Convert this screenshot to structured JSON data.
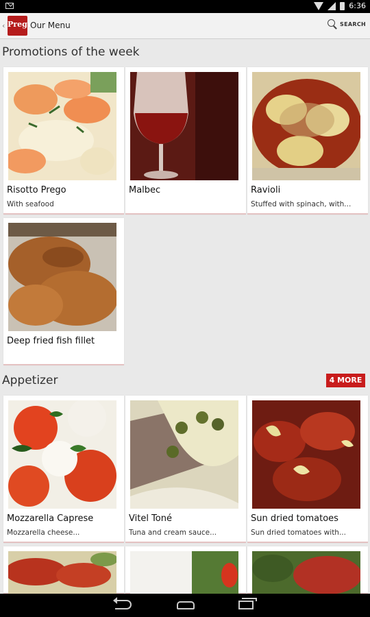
{
  "status": {
    "time": "6:36"
  },
  "app": {
    "title": "Our Menu",
    "logo_text": "Prego",
    "search_label": "SEARCH"
  },
  "sections": [
    {
      "title": "Promotions of the week",
      "items": [
        {
          "name": "Risotto Prego",
          "description": "With seafood"
        },
        {
          "name": "Malbec",
          "description": ""
        },
        {
          "name": "Ravioli",
          "description": "Stuffed with spinach, with..."
        },
        {
          "name": "Deep fried fish fillet",
          "description": ""
        }
      ]
    },
    {
      "title": "Appetizer",
      "more_label": "4 MORE",
      "items": [
        {
          "name": "Mozzarella Caprese",
          "description": "Mozzarella cheese..."
        },
        {
          "name": "Vitel Toné",
          "description": "Tuna and cream sauce..."
        },
        {
          "name": "Sun dried tomatoes",
          "description": "Sun dried tomatoes with..."
        }
      ]
    }
  ],
  "colors": {
    "accent": "#c81c1c",
    "background": "#e9e9e9"
  }
}
